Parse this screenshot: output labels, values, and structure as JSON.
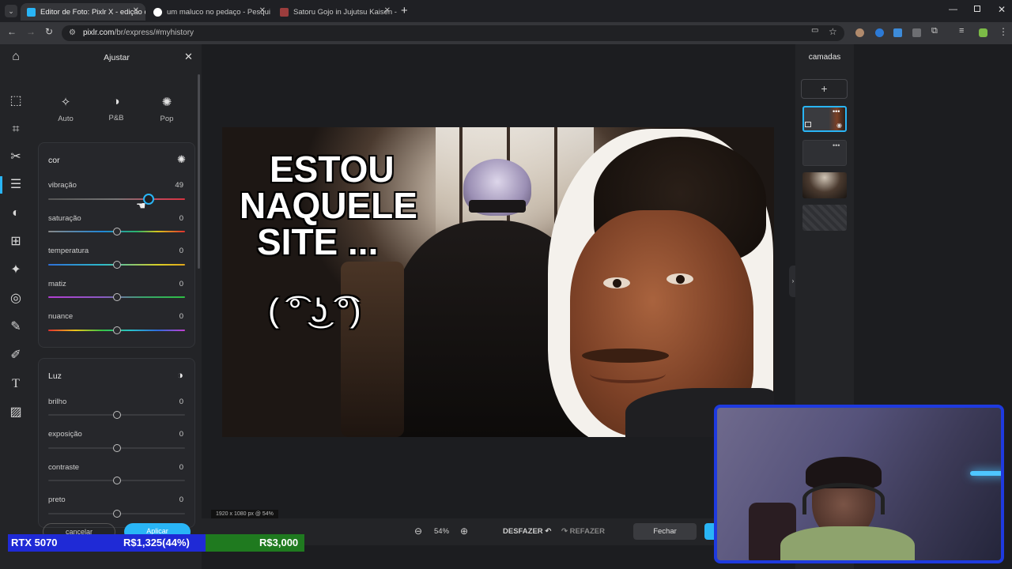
{
  "browser": {
    "tabs": [
      {
        "title": "Editor de Foto: Pixlr X - edição c"
      },
      {
        "title": "um maluco no pedaço - Pesqui"
      },
      {
        "title": "Satoru Gojo in Jujutsu Kaisen -"
      }
    ],
    "new_tab": "+",
    "url_domain": "pixlr.com",
    "url_path": "/br/express/#myhistory"
  },
  "adjust_panel": {
    "title": "Ajustar",
    "presets": [
      "Auto",
      "P&B",
      "Pop"
    ],
    "color_section": {
      "title": "cor",
      "sliders": [
        {
          "label": "vibração",
          "value": "49",
          "fraction": 0.735
        },
        {
          "label": "saturação",
          "value": "0",
          "fraction": 0.5
        },
        {
          "label": "temperatura",
          "value": "0",
          "fraction": 0.5
        },
        {
          "label": "matiz",
          "value": "0",
          "fraction": 0.5
        },
        {
          "label": "nuance",
          "value": "0",
          "fraction": 0.5
        }
      ]
    },
    "light_section": {
      "title": "Luz",
      "sliders": [
        {
          "label": "brilho",
          "value": "0",
          "fraction": 0.5
        },
        {
          "label": "exposição",
          "value": "0",
          "fraction": 0.5
        },
        {
          "label": "contraste",
          "value": "0",
          "fraction": 0.5
        },
        {
          "label": "preto",
          "value": "0",
          "fraction": 0.5
        }
      ]
    },
    "cancel_label": "cancelar",
    "apply_label": "Aplicar"
  },
  "canvas": {
    "meme_line1": "ESTOU",
    "meme_line2": "NAQUELE",
    "meme_line3": "SITE ...",
    "lenny_face": "( ͡° ͜ʖ ͡°)",
    "image_info": "1920 x 1080 px @ 54%"
  },
  "bottom_bar": {
    "zoom": "54%",
    "undo_label": "DESFAZER",
    "redo_label": "REFAZER",
    "close_label": "Fechar"
  },
  "layers_panel": {
    "title": "camadas",
    "add_label": "+"
  },
  "stream_overlay": {
    "item": "RTX 5070",
    "progress": "R$1,325(44%)",
    "goal": "R$3,000",
    "progress_fraction": 0.44
  },
  "colors": {
    "accent": "#29b5f6",
    "webcam_border": "#1e3adf",
    "overlay_blue": "#1f2ad6",
    "overlay_green": "#1f7a1f"
  }
}
